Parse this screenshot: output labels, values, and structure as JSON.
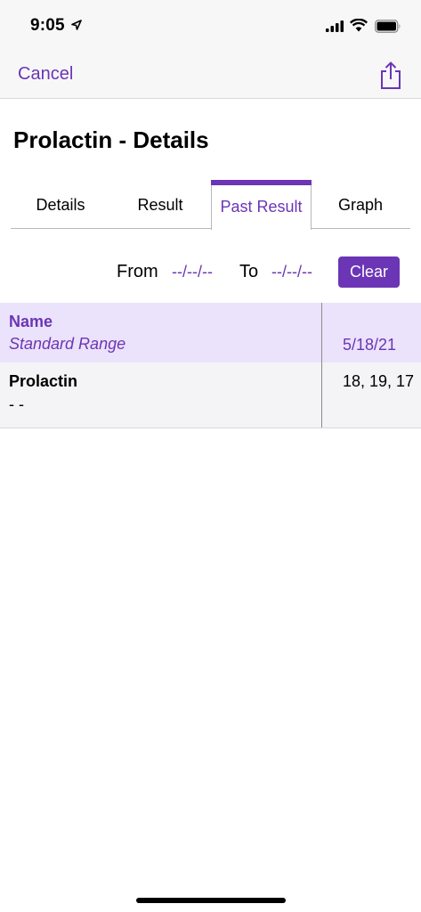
{
  "status_bar": {
    "time": "9:05"
  },
  "nav": {
    "cancel_label": "Cancel",
    "share_icon": "share-icon"
  },
  "page": {
    "title": "Prolactin - Details"
  },
  "tabs": [
    {
      "label": "Details",
      "selected": false
    },
    {
      "label": "Result",
      "selected": false
    },
    {
      "label": "Past Result",
      "selected": true
    },
    {
      "label": "Graph",
      "selected": false
    }
  ],
  "filter": {
    "from_label": "From",
    "from_value": "--/--/--",
    "to_label": "To",
    "to_value": "--/--/--",
    "clear_label": "Clear"
  },
  "table": {
    "header": {
      "name": "Name",
      "standard_range": "Standard Range",
      "date": "5/18/21"
    },
    "rows": [
      {
        "name": "Prolactin",
        "range": "- -",
        "values": "18, 19, 17"
      }
    ]
  },
  "colors": {
    "accent": "#6b35b5",
    "header_bg": "#ebe2fb",
    "row_bg": "#f4f4f6"
  }
}
